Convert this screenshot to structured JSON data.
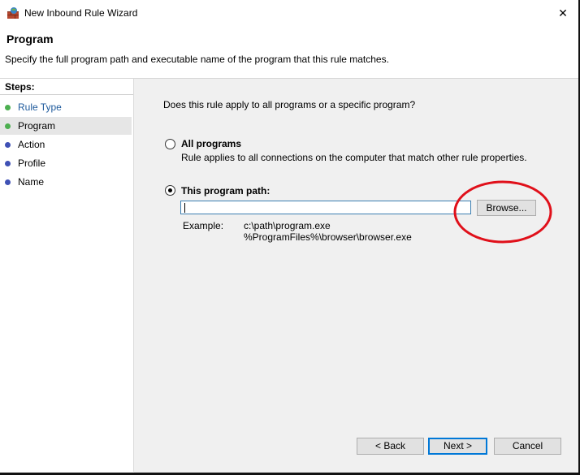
{
  "window": {
    "title": "New Inbound Rule Wizard",
    "close_glyph": "✕"
  },
  "header": {
    "title": "Program",
    "description": "Specify the full program path and executable name of the program that this rule matches."
  },
  "sidebar": {
    "header": "Steps:",
    "items": [
      {
        "label": "Rule Type",
        "state": "completed",
        "dot_color": "#4caf50",
        "text_color": "#1e5a9c"
      },
      {
        "label": "Program",
        "state": "current",
        "dot_color": "#4caf50",
        "text_color": "#000000"
      },
      {
        "label": "Action",
        "state": "pending",
        "dot_color": "#3f51b5",
        "text_color": "#000000"
      },
      {
        "label": "Profile",
        "state": "pending",
        "dot_color": "#3f51b5",
        "text_color": "#000000"
      },
      {
        "label": "Name",
        "state": "pending",
        "dot_color": "#3f51b5",
        "text_color": "#000000"
      }
    ]
  },
  "main": {
    "question": "Does this rule apply to all programs or a specific program?",
    "options": [
      {
        "title": "All programs",
        "description": "Rule applies to all connections on the computer that match other rule properties.",
        "selected": false
      },
      {
        "title": "This program path:",
        "selected": true
      }
    ],
    "path_input": {
      "value": "",
      "placeholder": ""
    },
    "browse_label": "Browse...",
    "example": {
      "label": "Example:",
      "lines": [
        "c:\\path\\program.exe",
        "%ProgramFiles%\\browser\\browser.exe"
      ]
    }
  },
  "footer": {
    "back_label": "< Back",
    "next_label": "Next >",
    "cancel_label": "Cancel"
  },
  "annotation": {
    "shape": "ellipse",
    "color": "#e0101a"
  }
}
